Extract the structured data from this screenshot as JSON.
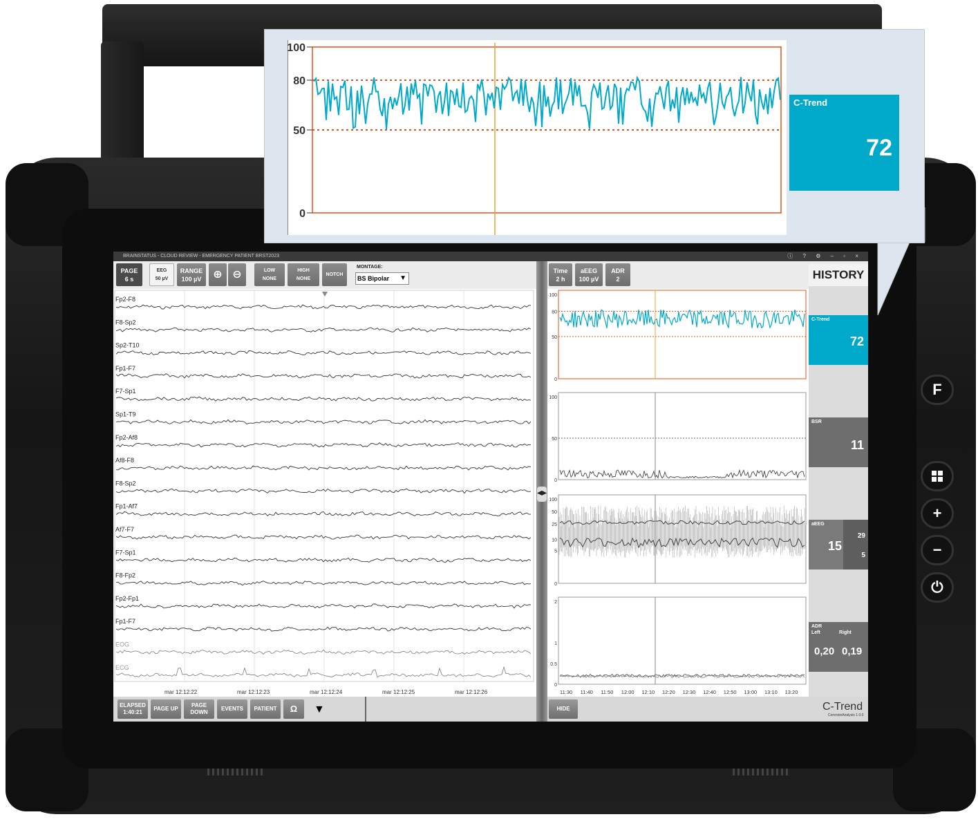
{
  "window": {
    "title": "BRAINSTATUS - CLOUD REVIEW - EMERGENCY PATIENT BRST2023"
  },
  "toolbar": {
    "page_label": "PAGE",
    "page_value": "6 s",
    "eeg_label": "EEG",
    "eeg_value": "50 µV",
    "range_label": "RANGE",
    "range_value": "100 µV",
    "low_label": "LOW",
    "low_value": "NONE",
    "high_label": "HIGH",
    "high_value": "NONE",
    "notch_label": "NOTCH",
    "montage_label": "MONTAGE:",
    "montage_value": "BS Bipolar"
  },
  "channels": [
    "Fp2-F8",
    "F8-Sp2",
    "Sp2-T10",
    "Fp1-F7",
    "F7-Sp1",
    "Sp1-T9",
    "Fp2-Af8",
    "Af8-F8",
    "F8-Sp2",
    "Fp1-Af7",
    "Af7-F7",
    "F7-Sp1",
    "F8-Fp2",
    "Fp2-Fp1",
    "Fp1-F7",
    "EOG",
    "ECG"
  ],
  "time_axis": [
    "mar 12:12:22",
    "mar 12:12:23",
    "mar 12:12:24",
    "mar 12:12:25",
    "mar 12:12:26"
  ],
  "bottombar": {
    "elapsed_label": "ELAPSED",
    "elapsed_value": "1:40:21",
    "page_up": "PAGE UP",
    "page_down": "PAGE DOWN",
    "events": "EVENTS",
    "patient": "PATIENT",
    "omega": "Ω"
  },
  "right_toolbar": {
    "time_label": "Time",
    "time_value": "2 h",
    "aeeg_label": "aEEG",
    "aeeg_value": "100 µV",
    "adr_label": "ADR",
    "adr_value": "2",
    "history": "HISTORY"
  },
  "trend_axis": [
    "11:30",
    "11:40",
    "11:50",
    "12:00",
    "12:10",
    "12:20",
    "12:30",
    "12:40",
    "12:50",
    "13:00",
    "13:10",
    "13:20"
  ],
  "right_bottombar": {
    "hide": "HIDE"
  },
  "tiles": {
    "ctrend": {
      "label": "C-Trend",
      "value": "72"
    },
    "bsr": {
      "label": "BSR",
      "value": "11"
    },
    "aeeg": {
      "label": "aEEG",
      "unit": "µV",
      "value": "15",
      "upper": "29",
      "lower": "5"
    },
    "adr": {
      "label": "ADR",
      "left_label": "Left",
      "right_label": "Right",
      "left_value": "0,20",
      "right_value": "0,19"
    }
  },
  "logo": {
    "name": "C-Trend",
    "version": "CerenionAnalysis 1.0.0"
  },
  "callout": {
    "label": "C-Trend",
    "value": "72",
    "yticks": [
      "100",
      "80",
      "50",
      "0"
    ]
  },
  "colors": {
    "ctrend": "#00a9c9",
    "threshold": "#e8501a",
    "cursor": "#f0a030",
    "tile_gray": "#6e6e6e"
  },
  "chart_data": [
    {
      "type": "line",
      "title": "C-Trend",
      "ylim": [
        0,
        100
      ],
      "yticks": [
        0,
        50,
        80,
        100
      ],
      "thresholds": [
        50,
        80
      ],
      "series": [
        {
          "name": "C-Trend",
          "summary": "fluctuates mostly between 55 and 80",
          "current": 72
        }
      ]
    },
    {
      "type": "line",
      "title": "BSR",
      "ylim": [
        0,
        100
      ],
      "yticks": [
        0,
        50,
        100
      ],
      "threshold": 50,
      "current": 11
    },
    {
      "type": "line",
      "title": "aEEG",
      "ylim": [
        0,
        100
      ],
      "yticks": [
        0,
        5,
        10,
        25,
        50,
        100
      ],
      "current": 15,
      "upper": 29,
      "lower": 5
    },
    {
      "type": "line",
      "title": "ADR",
      "ylim": [
        0,
        2
      ],
      "yticks": [
        0,
        0.5,
        1,
        2
      ],
      "left": 0.2,
      "right": 0.19
    }
  ]
}
